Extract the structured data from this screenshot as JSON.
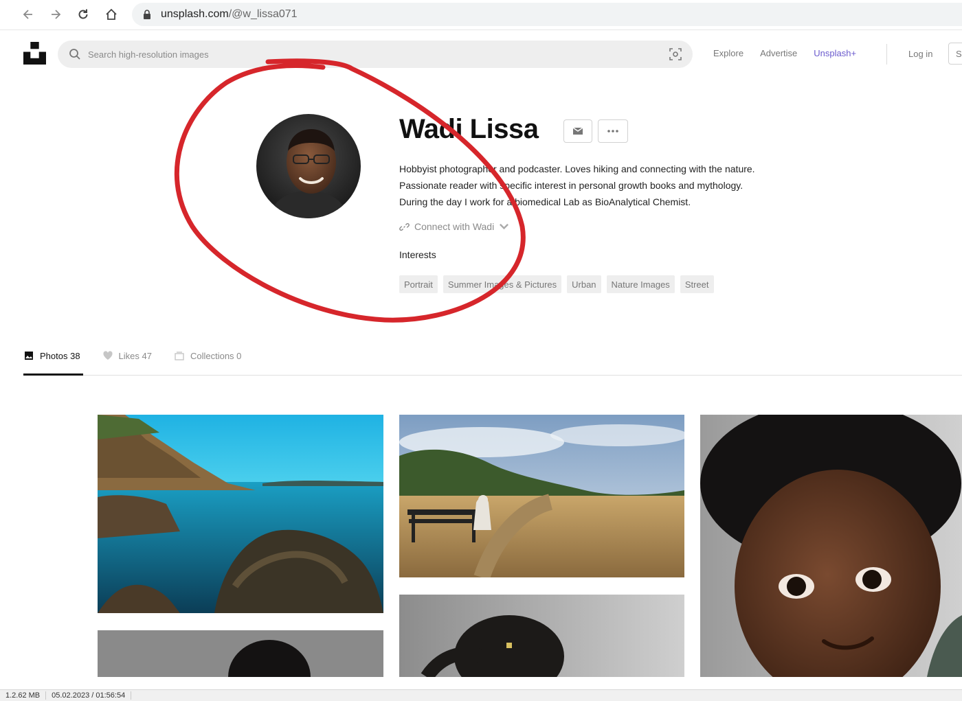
{
  "browser": {
    "url_domain": "unsplash.com",
    "url_path": "/@w_lissa071"
  },
  "header": {
    "search_placeholder": "Search high-resolution images",
    "nav": [
      "Explore",
      "Advertise",
      "Unsplash+"
    ],
    "login": "Log in",
    "submit_partial": "S"
  },
  "profile": {
    "name": "Wadi Lissa",
    "bio_lines": [
      "Hobbyist photographer and podcaster. Loves hiking and connecting with the nature.",
      "Passionate reader with specific interest in personal growth books and mythology.",
      "During the day I work for a biomedical Lab as BioAnalytical Chemist."
    ],
    "connect": "Connect with Wadi",
    "interests_label": "Interests",
    "interests": [
      "Portrait",
      "Summer Images & Pictures",
      "Urban",
      "Nature Images",
      "Street"
    ]
  },
  "tabs": [
    {
      "label": "Photos 38",
      "icon": "image-icon",
      "active": true
    },
    {
      "label": "Likes 47",
      "icon": "heart-icon",
      "active": false
    },
    {
      "label": "Collections 0",
      "icon": "collection-icon",
      "active": false
    }
  ],
  "photos": [
    {
      "name": "photo-coast"
    },
    {
      "name": "photo-bench-field"
    },
    {
      "name": "photo-child-portrait"
    },
    {
      "name": "photo-dark-hair"
    },
    {
      "name": "photo-dreadlocks"
    }
  ],
  "status_bar": {
    "size": "1.2.62 MB",
    "date": "05.02.2023 / 01:56:54"
  },
  "colors": {
    "annotation_red": "#d6262b",
    "accent_purple": "#6a5acd"
  }
}
